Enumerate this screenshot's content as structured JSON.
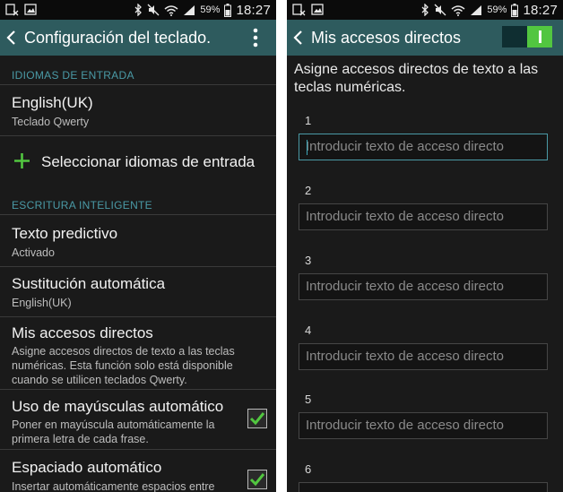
{
  "status_bar": {
    "battery_percent": "59%",
    "time": "18:27",
    "icons": [
      "screenshot-icon",
      "image-icon",
      "bluetooth-icon",
      "mute-icon",
      "wifi-icon",
      "signal-icon",
      "battery-icon"
    ]
  },
  "left_screen": {
    "title": "Configuración del teclado.",
    "sections": {
      "input_languages": "IDIOMAS DE ENTRADA",
      "smart_typing": "ESCRITURA INTELIGENTE"
    },
    "language": {
      "title": "English(UK)",
      "subtitle": "Teclado Qwerty"
    },
    "add_languages": {
      "label": "Seleccionar idiomas de entrada",
      "icon": "plus-icon"
    },
    "items": [
      {
        "title": "Texto predictivo",
        "subtitle": "Activado"
      },
      {
        "title": "Sustitución automática",
        "subtitle": "English(UK)"
      },
      {
        "title": "Mis accesos directos",
        "subtitle": "Asigne accesos directos de texto a las teclas numéricas. Esta función solo está disponible cuando se utilicen teclados Qwerty."
      },
      {
        "title": "Uso de mayúsculas automático",
        "subtitle": "Poner en mayúscula automáticamente la primera letra de cada frase.",
        "checked": true
      },
      {
        "title": "Espaciado automático",
        "subtitle": "Insertar automáticamente espacios entre",
        "checked": true
      }
    ]
  },
  "right_screen": {
    "title": "Mis accesos directos",
    "toggle_on": true,
    "intro": "Asigne accesos directos de texto a las teclas numéricas.",
    "placeholder": "Introducir texto de acceso directo",
    "shortcuts": [
      "1",
      "2",
      "3",
      "4",
      "5",
      "6"
    ]
  },
  "colors": {
    "app_bar": "#2e5b5e",
    "background": "#1a1a1a",
    "section_header": "#4a9aa6",
    "check_green": "#52c640"
  }
}
